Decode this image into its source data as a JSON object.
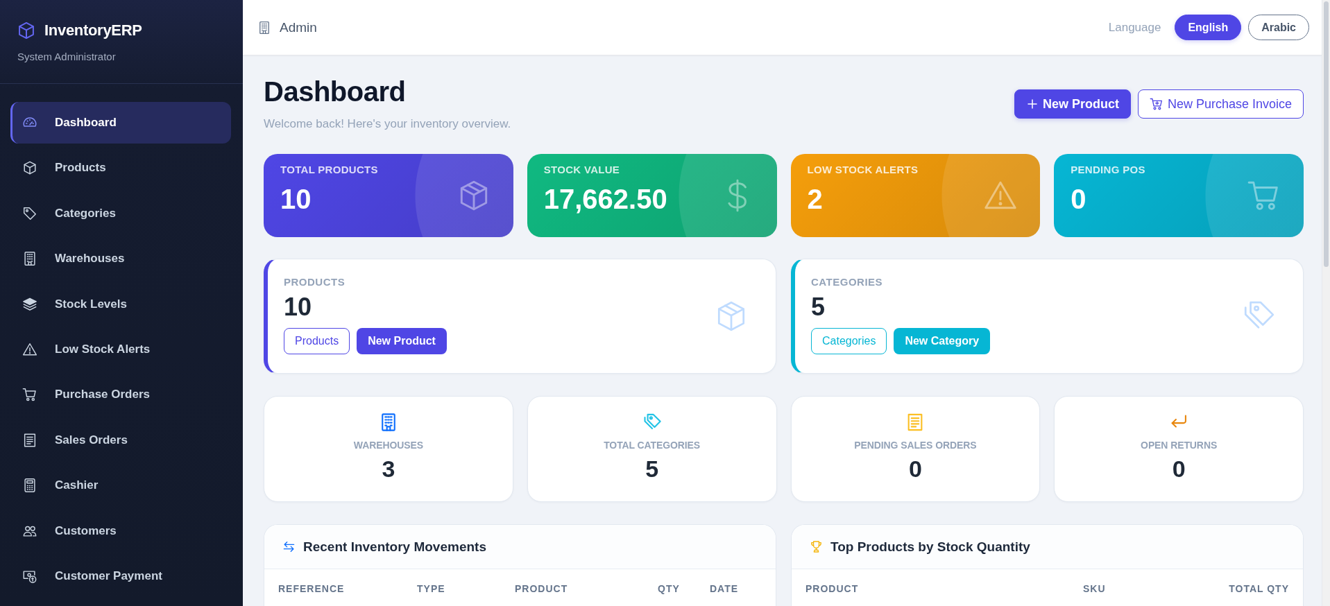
{
  "sidebar": {
    "brand": "InventoryERP",
    "subtitle": "System Administrator",
    "items": [
      {
        "label": "Dashboard",
        "selected": true
      },
      {
        "label": "Products",
        "selected": false
      },
      {
        "label": "Categories",
        "selected": false
      },
      {
        "label": "Warehouses",
        "selected": false
      },
      {
        "label": "Stock Levels",
        "selected": false
      },
      {
        "label": "Low Stock Alerts",
        "selected": false
      },
      {
        "label": "Purchase Orders",
        "selected": false
      },
      {
        "label": "Sales Orders",
        "selected": false
      },
      {
        "label": "Cashier",
        "selected": false
      },
      {
        "label": "Customers",
        "selected": false
      },
      {
        "label": "Customer Payment",
        "selected": false
      }
    ]
  },
  "header": {
    "title": "Admin",
    "language_label": "Language",
    "languages": [
      {
        "label": "English",
        "selected": true
      },
      {
        "label": "Arabic",
        "selected": false
      }
    ]
  },
  "page": {
    "title": "Dashboard",
    "subtitle": "Welcome back! Here's your inventory overview.",
    "actions": [
      {
        "label": "New Product",
        "kind": "primary"
      },
      {
        "label": "New Purchase Invoice",
        "kind": "secondary"
      }
    ]
  },
  "stat_cards": [
    {
      "label": "TOTAL PRODUCTS",
      "value": "10",
      "color": "#4f46e5"
    },
    {
      "label": "STOCK VALUE",
      "value": "17,662.50",
      "color": "#10b981"
    },
    {
      "label": "LOW STOCK ALERTS",
      "value": "2",
      "color": "#f59e0b"
    },
    {
      "label": "PENDING POS",
      "value": "0",
      "color": "#06b6d4"
    }
  ],
  "summary_cards": [
    {
      "label": "PRODUCTS",
      "value": "10",
      "color": "#4f46e5",
      "buttons": [
        {
          "label": "Products",
          "kind": "secondary"
        },
        {
          "label": "New Product",
          "kind": "primary"
        }
      ]
    },
    {
      "label": "CATEGORIES",
      "value": "5",
      "color": "#06b6d4",
      "buttons": [
        {
          "label": "Categories",
          "kind": "secondary"
        },
        {
          "label": "New Category",
          "kind": "primary"
        }
      ]
    }
  ],
  "metric_cards": [
    {
      "label": "WAREHOUSES",
      "value": "3",
      "color": "#0d6efd"
    },
    {
      "label": "TOTAL CATEGORIES",
      "value": "5",
      "color": "#22c3e6"
    },
    {
      "label": "PENDING SALES ORDERS",
      "value": "0",
      "color": "#fbbf24"
    },
    {
      "label": "OPEN RETURNS",
      "value": "0",
      "color": "#e8870e"
    }
  ],
  "panels": [
    {
      "title": "Recent Inventory Movements",
      "columns": [
        "REFERENCE",
        "TYPE",
        "PRODUCT",
        "QTY",
        "DATE"
      ]
    },
    {
      "title": "Top Products by Stock Quantity",
      "columns": [
        "PRODUCT",
        "SKU",
        "TOTAL QTY"
      ]
    }
  ]
}
